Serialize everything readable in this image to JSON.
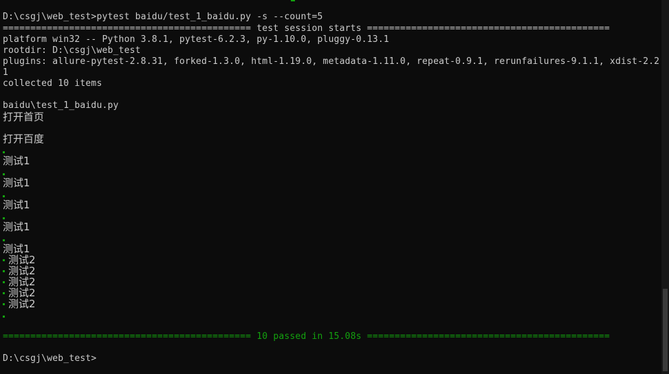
{
  "terminal": {
    "command_line": "D:\\csgj\\web_test>pytest baidu/test_1_baidu.py -s --count=5",
    "session_header": "============================================= test session starts ============================================",
    "platform": "platform win32 -- Python 3.8.1, pytest-6.2.3, py-1.10.0, pluggy-0.13.1",
    "rootdir": "rootdir: D:\\csgj\\web_test",
    "plugins_line1": "plugins: allure-pytest-2.8.31, forked-1.3.0, html-1.19.0, metadata-1.11.0, repeat-0.9.1, rerunfailures-9.1.1, xdist-2.2.",
    "plugins_line2": "1",
    "collected": "collected 10 items",
    "test_file": "baidu\\test_1_baidu.py",
    "open_home": "打开首页",
    "open_baidu": "打开百度",
    "test1": [
      "测试1",
      "测试1",
      "测试1",
      "测试1",
      "测试1"
    ],
    "test2": [
      "测试2",
      "测试2",
      "测试2",
      "测试2",
      "测试2"
    ],
    "summary_left": "============================================= ",
    "summary_text": "10 passed in 15.08s",
    "summary_right": " ============================================",
    "prompt": "D:\\csgj\\web_test>"
  },
  "colors": {
    "background": "#0c0c0c",
    "text": "#cccccc",
    "pass_green": "#13a10e"
  }
}
